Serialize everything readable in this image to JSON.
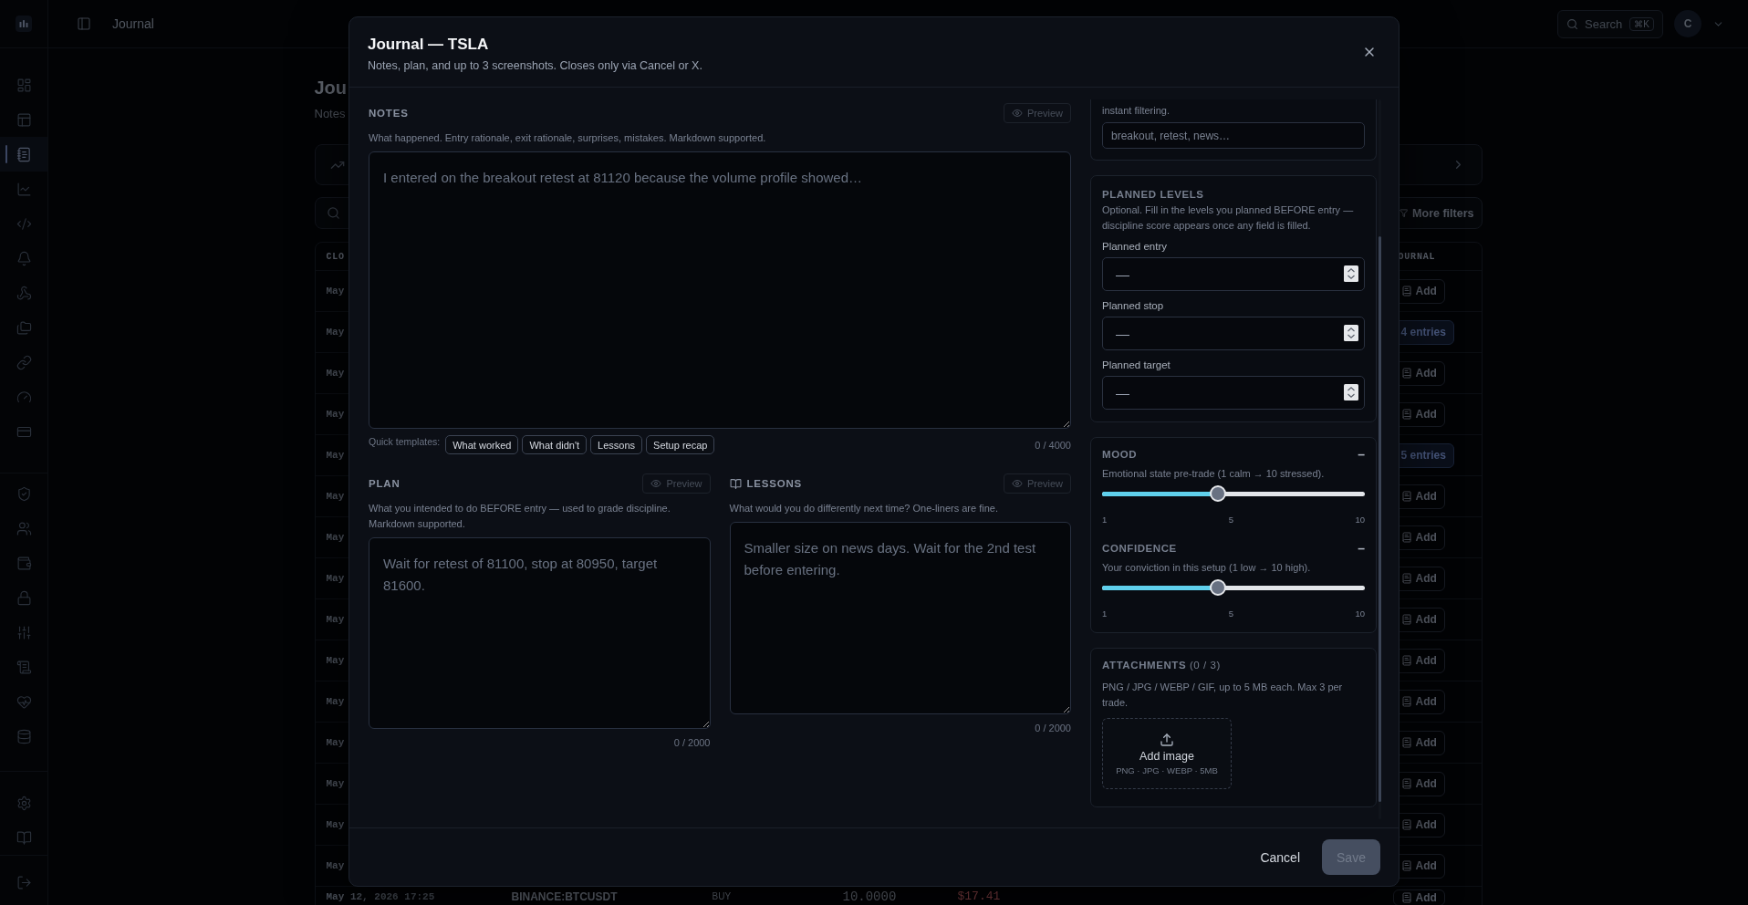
{
  "sidebar": {
    "groups": [
      [
        {
          "selected": false
        },
        {
          "selected": false
        },
        {
          "selected": true
        },
        {
          "selected": false
        },
        {
          "selected": false
        },
        {
          "selected": false
        },
        {
          "selected": false
        },
        {
          "selected": false
        },
        {
          "selected": false
        },
        {
          "selected": false
        },
        {
          "selected": false
        }
      ],
      [
        {
          "selected": false
        },
        {
          "selected": false
        },
        {
          "selected": false
        },
        {
          "selected": false
        },
        {
          "selected": false
        },
        {
          "selected": false
        },
        {
          "selected": false
        },
        {
          "selected": false
        }
      ],
      [
        {
          "selected": false
        },
        {
          "selected": false
        }
      ],
      [
        {
          "selected": false
        }
      ]
    ]
  },
  "topbar": {
    "title": "Journal",
    "search": {
      "placeholder": "Search",
      "shortcut": "⌘K"
    },
    "avatar": "C"
  },
  "page": {
    "title": "Jou",
    "subtitle": "Notes",
    "more_filters": "More filters",
    "table": {
      "columns": [
        "CLO",
        "OURNAL"
      ],
      "rows": [
        {
          "cells": [
            "May"
          ],
          "journal": {
            "kind": "add",
            "label": "Add"
          }
        },
        {
          "cells": [
            "May"
          ],
          "journal": {
            "kind": "entries",
            "label": "4 entries"
          }
        },
        {
          "cells": [
            "May"
          ],
          "journal": {
            "kind": "add",
            "label": "Add"
          }
        },
        {
          "cells": [
            "May"
          ],
          "journal": {
            "kind": "add",
            "label": "Add"
          }
        },
        {
          "cells": [
            "May"
          ],
          "journal": {
            "kind": "entries",
            "label": "5 entries"
          }
        },
        {
          "cells": [
            "May"
          ],
          "journal": {
            "kind": "add",
            "label": "Add"
          }
        },
        {
          "cells": [
            "May"
          ],
          "journal": {
            "kind": "add",
            "label": "Add"
          }
        },
        {
          "cells": [
            "May"
          ],
          "journal": {
            "kind": "add",
            "label": "Add"
          }
        },
        {
          "cells": [
            "May"
          ],
          "journal": {
            "kind": "add",
            "label": "Add"
          }
        },
        {
          "cells": [
            "May"
          ],
          "journal": {
            "kind": "add",
            "label": "Add"
          }
        },
        {
          "cells": [
            "May"
          ],
          "journal": {
            "kind": "add",
            "label": "Add"
          }
        },
        {
          "cells": [
            "May"
          ],
          "journal": {
            "kind": "add",
            "label": "Add"
          }
        },
        {
          "cells": [
            "May"
          ],
          "journal": {
            "kind": "add",
            "label": "Add"
          }
        },
        {
          "cells": [
            "May"
          ],
          "journal": {
            "kind": "add",
            "label": "Add"
          }
        },
        {
          "cells": [
            "May"
          ],
          "journal": {
            "kind": "add",
            "label": "Add"
          }
        },
        {
          "cells": [
            "May 12, 2026 17:25",
            "BINANCE:BTCUSDT",
            "BUY",
            "10.0000",
            "$17.41"
          ],
          "journal": {
            "kind": "add",
            "label": "Add"
          }
        }
      ]
    }
  },
  "modal": {
    "title": "Journal — TSLA",
    "subtitle": "Notes, plan, and up to 3 screenshots. Closes only via Cancel or X.",
    "notes": {
      "label": "NOTES",
      "preview": {
        "label": "Preview",
        "disabled": true
      },
      "description": "What happened. Entry rationale, exit rationale, surprises, mistakes. Markdown supported.",
      "placeholder": "I entered on the breakout retest at 81120 because the volume profile showed…",
      "templates_label": "Quick templates:",
      "templates": [
        "What worked",
        "What didn't",
        "Lessons",
        "Setup recap"
      ],
      "counter": "0 / 4000"
    },
    "plan": {
      "label": "PLAN",
      "preview": {
        "label": "Preview",
        "disabled": true
      },
      "description": "What you intended to do BEFORE entry — used to grade discipline. Markdown supported.",
      "placeholder": "Wait for retest of 81100, stop at 80950, target 81600.",
      "counter": "0 / 2000"
    },
    "lessons": {
      "label": "LESSONS",
      "preview": {
        "label": "Preview",
        "disabled": true
      },
      "description": "What would you do differently next time? One-liners are fine.",
      "placeholder": "Smaller size on news days. Wait for the 2nd test before entering.",
      "counter": "0 / 2000"
    },
    "tags": {
      "description": "instant filtering.",
      "placeholder": "breakout, retest, news…"
    },
    "planned_levels": {
      "title": "PLANNED LEVELS",
      "description": "Optional. Fill in the levels you planned BEFORE entry — discipline score appears once any field is filled.",
      "fields": [
        {
          "label": "Planned entry",
          "placeholder": "—"
        },
        {
          "label": "Planned stop",
          "placeholder": "—"
        },
        {
          "label": "Planned target",
          "placeholder": "—"
        }
      ]
    },
    "ratings": [
      {
        "title": "MOOD",
        "value": "–",
        "description": "Emotional state pre-trade (1 calm → 10 stressed).",
        "level": 0.44,
        "ticks": [
          "1",
          "5",
          "10"
        ]
      },
      {
        "title": "CONFIDENCE",
        "value": "–",
        "description": "Your conviction in this setup (1 low → 10 high).",
        "level": 0.44,
        "ticks": [
          "1",
          "5",
          "10"
        ]
      }
    ],
    "attachments": {
      "title": "**ATTACHMENTS** (0 / 3)",
      "description": "PNG / JPG / WEBP / GIF, up to 5 MB each. Max 3 per trade.",
      "dropzone": {
        "label": "Add image",
        "hint": "PNG · JPG · WEBP · 5MB"
      }
    },
    "footer": {
      "cancel": "Cancel",
      "save": {
        "label": "Save",
        "disabled": true
      }
    }
  }
}
